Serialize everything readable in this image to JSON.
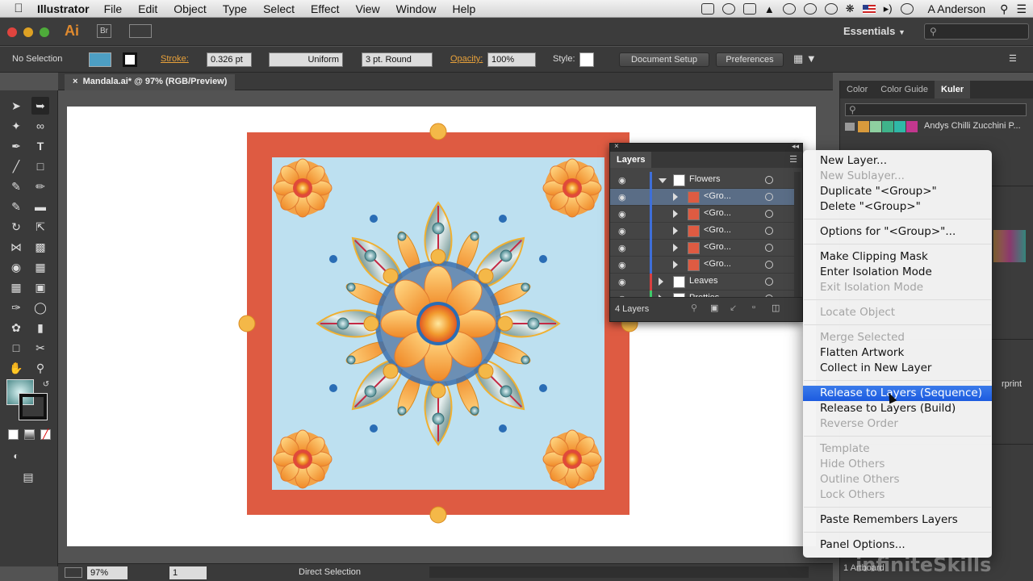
{
  "menubar": {
    "app": "Illustrator",
    "items": [
      "File",
      "Edit",
      "Object",
      "Type",
      "Select",
      "Effect",
      "View",
      "Window",
      "Help"
    ],
    "user": "A Anderson"
  },
  "appbar": {
    "logo": "Ai",
    "bridge": "Br",
    "workspace": "Essentials"
  },
  "control": {
    "selection": "No Selection",
    "stroke_label": "Stroke:",
    "stroke_value": "0.326 pt",
    "profile": "Uniform",
    "brush": "3 pt. Round",
    "opacity_label": "Opacity:",
    "opacity_value": "100%",
    "style_label": "Style:",
    "doc_setup": "Document Setup",
    "preferences": "Preferences"
  },
  "document": {
    "tab": "Mandala.ai* @ 97% (RGB/Preview)"
  },
  "status": {
    "zoom": "97%",
    "page": "1",
    "tool": "Direct Selection",
    "artboards": "1 Artboard"
  },
  "dock": {
    "tabs": [
      "Color",
      "Color Guide",
      "Kuler"
    ],
    "kuler_theme": "Andys  Chilli Zucchini P...",
    "swatches": [
      "#d89a3c",
      "#8ed0a0",
      "#3fb38a",
      "#2fb8a7",
      "#c2378e"
    ],
    "partial_text": "rprint"
  },
  "layers": {
    "title": "Layers",
    "count": "4 Layers",
    "rows": [
      {
        "name": "Flowers",
        "level": 0,
        "expanded": true,
        "selected": false,
        "color": "#3e6fd9"
      },
      {
        "name": "<Gro...",
        "level": 1,
        "expanded": false,
        "selected": true,
        "color": "#3e6fd9"
      },
      {
        "name": "<Gro...",
        "level": 1,
        "expanded": false,
        "selected": false,
        "color": "#3e6fd9"
      },
      {
        "name": "<Gro...",
        "level": 1,
        "expanded": false,
        "selected": false,
        "color": "#3e6fd9"
      },
      {
        "name": "<Gro...",
        "level": 1,
        "expanded": false,
        "selected": false,
        "color": "#3e6fd9"
      },
      {
        "name": "<Gro...",
        "level": 1,
        "expanded": false,
        "selected": false,
        "color": "#3e6fd9"
      },
      {
        "name": "Leaves",
        "level": 0,
        "expanded": false,
        "selected": false,
        "color": "#d94040"
      },
      {
        "name": "Pretties",
        "level": 0,
        "expanded": false,
        "selected": false,
        "color": "#3ec96a"
      }
    ]
  },
  "menu": {
    "items": [
      {
        "label": "New Layer...",
        "disabled": false
      },
      {
        "label": "New Sublayer...",
        "disabled": true
      },
      {
        "label": "Duplicate \"<Group>\"",
        "disabled": false
      },
      {
        "label": "Delete \"<Group>\"",
        "disabled": false
      },
      {
        "sep": true
      },
      {
        "label": "Options for \"<Group>\"...",
        "disabled": false
      },
      {
        "sep": true
      },
      {
        "label": "Make Clipping Mask",
        "disabled": false
      },
      {
        "label": "Enter Isolation Mode",
        "disabled": false
      },
      {
        "label": "Exit Isolation Mode",
        "disabled": true
      },
      {
        "sep": true
      },
      {
        "label": "Locate Object",
        "disabled": true
      },
      {
        "sep": true
      },
      {
        "label": "Merge Selected",
        "disabled": true
      },
      {
        "label": "Flatten Artwork",
        "disabled": false
      },
      {
        "label": "Collect in New Layer",
        "disabled": false
      },
      {
        "sep": true
      },
      {
        "label": "Release to Layers (Sequence)",
        "disabled": false,
        "highlighted": true
      },
      {
        "label": "Release to Layers (Build)",
        "disabled": false
      },
      {
        "label": "Reverse Order",
        "disabled": true
      },
      {
        "sep": true
      },
      {
        "label": "Template",
        "disabled": true
      },
      {
        "label": "Hide Others",
        "disabled": true
      },
      {
        "label": "Outline Others",
        "disabled": true
      },
      {
        "label": "Lock Others",
        "disabled": true
      },
      {
        "sep": true
      },
      {
        "label": "Paste Remembers Layers",
        "disabled": false
      },
      {
        "sep": true
      },
      {
        "label": "Panel Options...",
        "disabled": false
      }
    ]
  },
  "watermark": "infiniteSkills",
  "colors": {
    "art_frame": "#de5b42",
    "art_bg": "#bde0f0",
    "petal_orange": "#f29a2e",
    "leaf_teal": "#3f6f6c",
    "accent_red": "#c42a45"
  }
}
